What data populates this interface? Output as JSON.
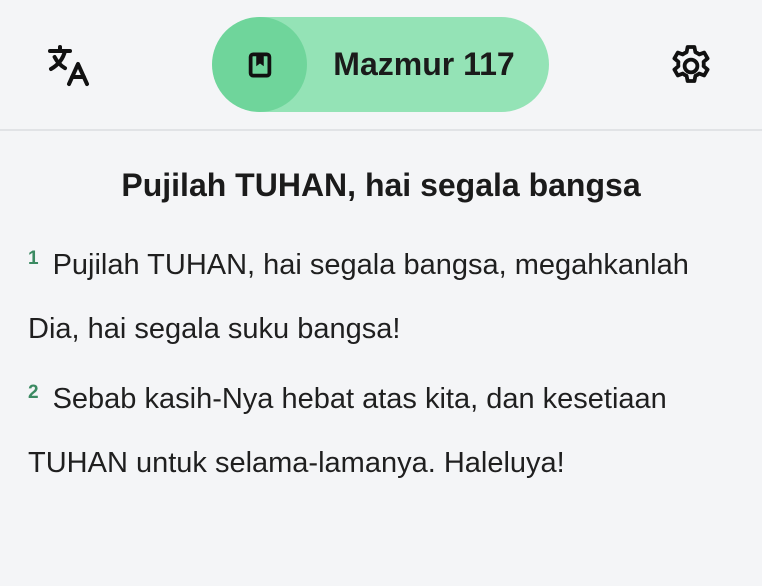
{
  "header": {
    "translate_icon": "translate-icon",
    "book_icon": "bookmark-icon",
    "book_label": "Mazmur 117",
    "settings_icon": "gear-icon"
  },
  "passage": {
    "heading": "Pujilah TUHAN, hai segala bangsa",
    "verses": [
      {
        "number": "1",
        "text": "Pujilah TUHAN, hai segala bangsa, megahkanlah Dia, hai segala suku bangsa!"
      },
      {
        "number": "2",
        "text": "Sebab kasih-Nya hebat atas kita, dan kesetiaan TUHAN untuk selama-lamanya. Haleluya!"
      }
    ]
  },
  "colors": {
    "pill_bg": "#94e3b6",
    "pill_icon_bg": "#6fd59b",
    "verse_number": "#3b8a62",
    "background": "#f4f5f7"
  }
}
